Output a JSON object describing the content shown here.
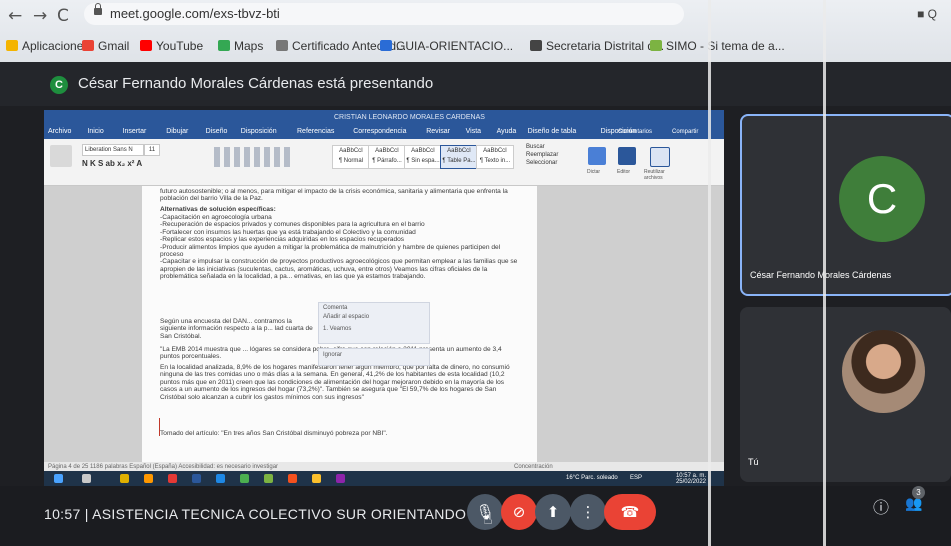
{
  "browser": {
    "url": "meet.google.com/exs-tbvz-bti",
    "bookmarks": [
      {
        "label": "Aplicaciones",
        "color": "#f4b400"
      },
      {
        "label": "Gmail",
        "color": "#ea4335"
      },
      {
        "label": "YouTube",
        "color": "#ff0000"
      },
      {
        "label": "Maps",
        "color": "#34a853"
      },
      {
        "label": "Certificado Anteced...",
        "color": "#777777"
      },
      {
        "label": "GUIA-ORIENTACIO...",
        "color": "#2a6cd6"
      },
      {
        "label": "Secretaria Distrital d...",
        "color": "#444444"
      },
      {
        "label": "SIMO - Si tema de a...",
        "color": "#7cb342"
      }
    ]
  },
  "meet": {
    "presenter_initial": "C",
    "presenting_text": "César Fernando Morales Cárdenas está presentando",
    "presenter_name": "César Fernando Morales Cárdenas",
    "self_label": "Tú",
    "meeting_time": "10:57",
    "meeting_title": "ASISTENCIA TECNICA COLECTIVO SUR ORIENTANDO",
    "people_count": "3"
  },
  "shared": {
    "window_title": "CRISTIAN LEONARDO MORALES CARDENAS",
    "tabs": [
      "Archivo",
      "Inicio",
      "Insertar",
      "Dibujar",
      "Diseño",
      "Disposición",
      "Referencias",
      "Correspondencia",
      "Revisar",
      "Vista",
      "Ayuda",
      "Diseño de tabla",
      "Disposición"
    ],
    "font_name": "Liberation Sans N",
    "font_size": "11",
    "styles": [
      "AaBbCcI",
      "AaBbCcI",
      "AaBbCcI",
      "AaBbCcI",
      "AaBbCcI"
    ],
    "style_names": [
      "¶ Normal",
      "¶ Párrafo...",
      "¶ Sin espa...",
      "¶ Table Pa...",
      "¶ Texto in..."
    ],
    "ribbon_tools": [
      "Buscar",
      "Reemplazar",
      "Seleccionar",
      "Dictar",
      "Editor",
      "Reutilizar archivos"
    ],
    "comments_label": "Comentarios",
    "share_label": "Compartir",
    "doc_lines_1": "futuro autosostenible; o al menos, para mitigar el impacto de la crisis económica, sanitaria y alimentaria que enfrenta la población del barrio Villa de la Paz.",
    "doc_heading": "Alternativas de solución específicas:",
    "doc_bullets": [
      "-Capacitación en agroecología urbana",
      "-Recuperación de espacios privados y comunes disponibles para la agricultura en el barrio",
      "-Fortalecer con insumos las huertas que ya está trabajando el Colectivo y la comunidad",
      "-Replicar estos espacios y las experiencias adquiridas en los espacios recuperados",
      "-Producir alimentos limpios que ayuden a mitigar la problemática de malnutrición y hambre de quienes participen del proceso",
      "-Capacitar e impulsar la construcción de proyectos productivos agroecológicos que permitan emplear a las familias que se apropien de las iniciativas (suculentas, cactus, aromáticas, uchuva, entre otros) Veamos las cifras oficiales de la problemática señalada en la localidad, a pa... ernativas, en las que ya estamos trabajando."
    ],
    "doc_lines_2": "Según una encuesta del DAN... contramos la siguiente información respecto a la p... lad cuarta de San Cristóbal.",
    "doc_lines_3": "\"La EMB 2014 muestra que ... lógares se considera pobre, cifra que con relación a 2011 presenta un aumento de 3,4 puntos porcentuales.",
    "doc_lines_4": "En la localidad analizada, 8,9% de los hogares manifestaron tener algún miembro, que por falta de dinero, no consumió ninguna de las tres comidas uno o más días a la semana. En general, 41,2% de los habitantes de esta localidad (10,2 puntos más que en 2011) creen que las condiciones de alimentación del hogar mejoraron debido en la mayoría de los casos a un aumento de los ingresos del hogar (73,2%)\". También se asegura que \"El 59,7% de los hogares de San Cristóbal solo alcanzan a cubrir los gastos mínimos con sus ingresos\"",
    "doc_lines_5": "Tomado del artículo: \"En tres años San Cristóbal disminuyó pobreza por NBI\".",
    "comment_a_lines": [
      "Comenta",
      "Añadir al espacio",
      "1. Veamos"
    ],
    "comment_b_line": "Ignorar",
    "status_left": "Página 4 de 25   1186 palabras   Español (España)   Accesibilidad: es necesario investigar",
    "status_right": "Concentración",
    "tb_weather": "16°C Parc. soleado",
    "tb_lang": "ESP",
    "tb_time": "10:57 a. m.",
    "tb_date": "25/02/2022"
  },
  "colors": {
    "word_blue": "#2b579a",
    "meet_red": "#ea4335",
    "meet_bg": "#1e1f23",
    "active_border": "#8ab4f8"
  },
  "icons": {
    "back": "arrow-left-icon",
    "forward": "arrow-right-icon",
    "reload": "reload-icon",
    "mic": "microphone-icon",
    "cam": "camera-off-icon",
    "present": "present-screen-icon",
    "more": "more-vert-icon",
    "hangup": "hangup-icon",
    "info": "info-icon",
    "people": "people-icon"
  }
}
